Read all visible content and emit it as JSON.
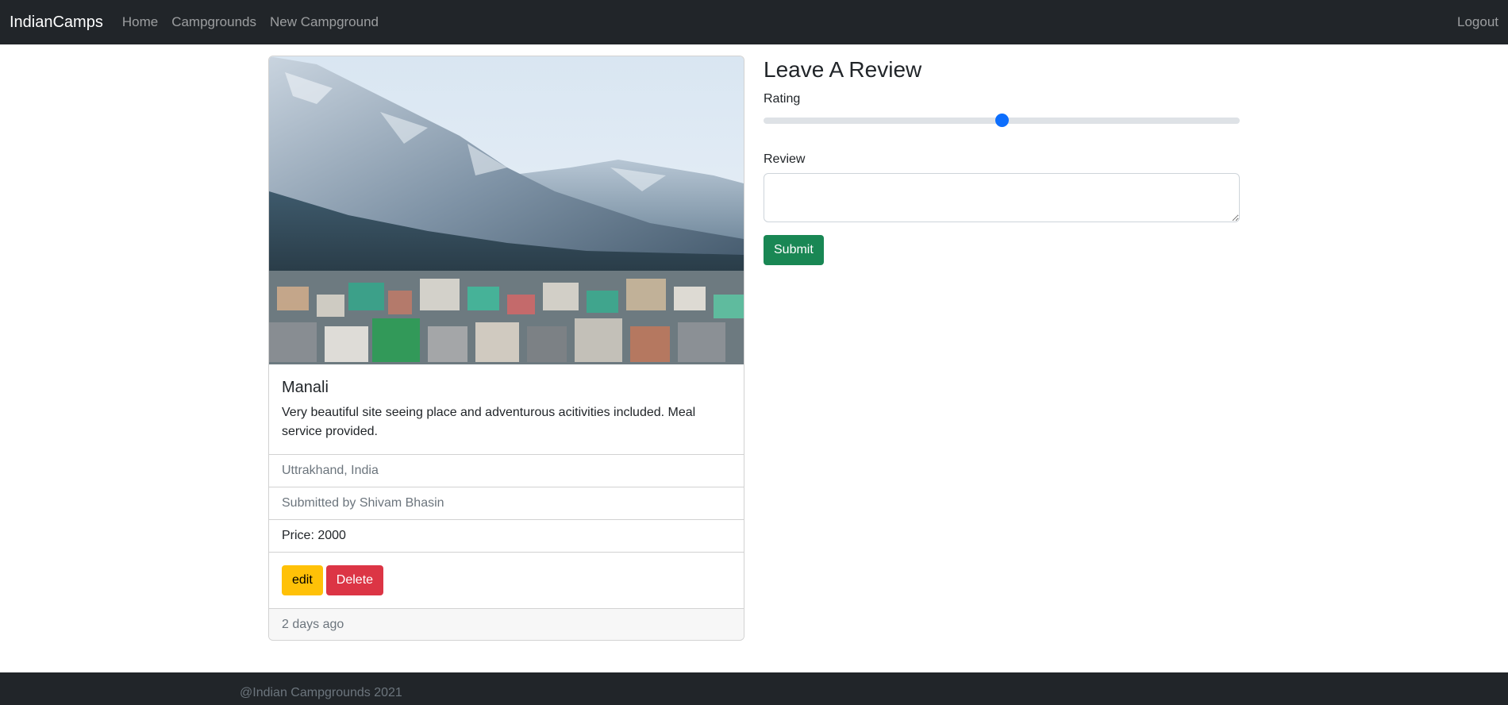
{
  "navbar": {
    "brand": "IndianCamps",
    "links": [
      "Home",
      "Campgrounds",
      "New Campground"
    ],
    "logout": "Logout"
  },
  "campground": {
    "title": "Manali",
    "description": "Very beautiful site seeing place and adventurous acitivities included. Meal service provided.",
    "location": "Uttrakhand, India",
    "submitted_by": "Submitted by Shivam Bhasin",
    "price": "Price: 2000",
    "edit_label": "edit",
    "delete_label": "Delete",
    "posted": "2 days ago"
  },
  "review_form": {
    "heading": "Leave A Review",
    "rating_label": "Rating",
    "rating_value_fraction": 0.5,
    "review_label": "Review",
    "review_value": "",
    "submit_label": "Submit"
  },
  "footer": {
    "text": "@Indian Campgrounds 2021"
  },
  "colors": {
    "navbar": "#212529",
    "primary": "#0d6efd",
    "warning": "#ffc107",
    "danger": "#dc3545",
    "success": "#198754"
  }
}
